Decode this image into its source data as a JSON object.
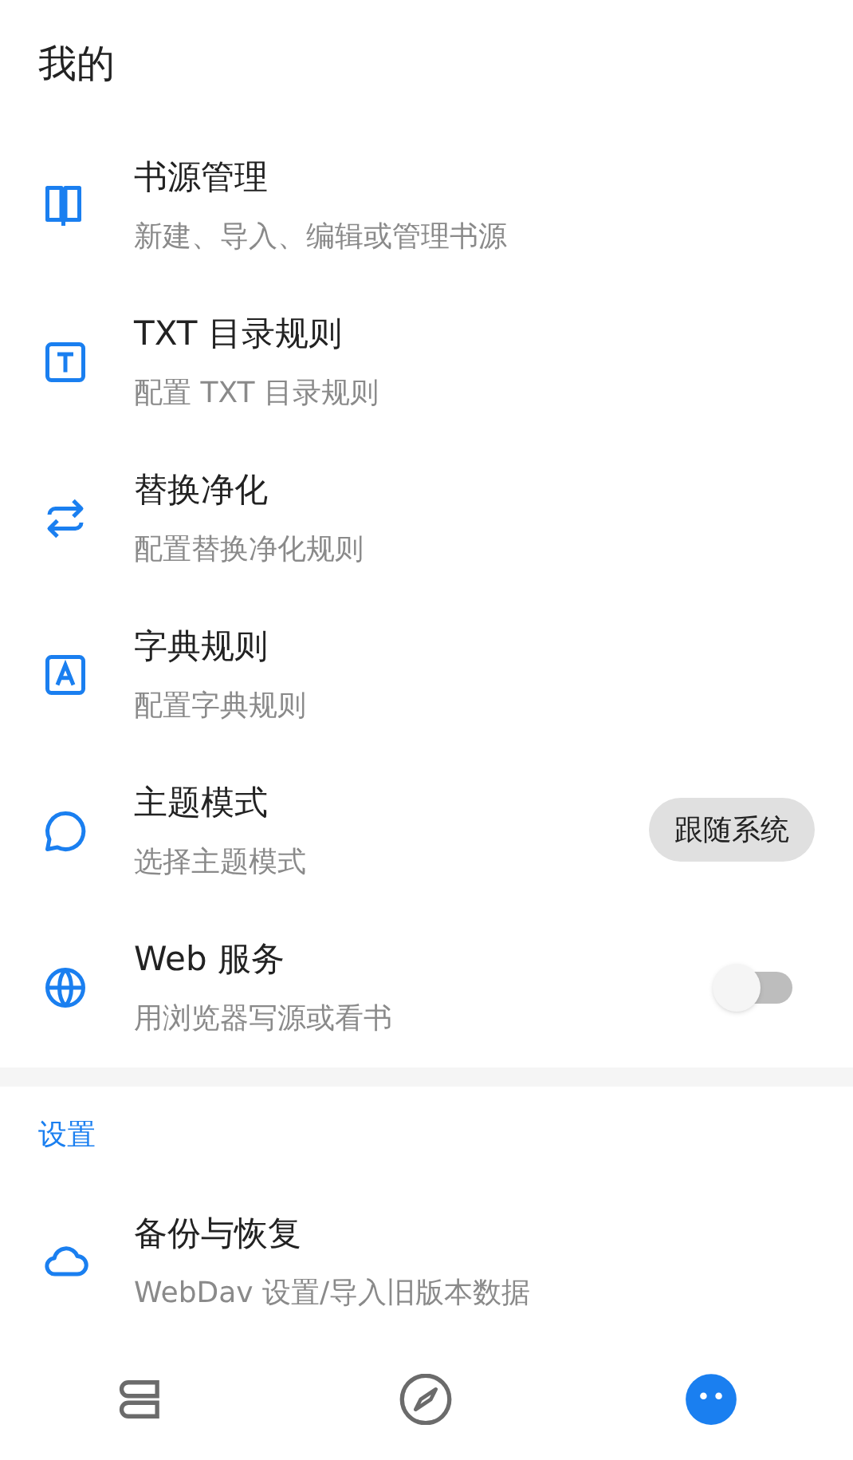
{
  "title": "我的",
  "items": [
    {
      "title": "书源管理",
      "subtitle": "新建、导入、编辑或管理书源"
    },
    {
      "title": "TXT 目录规则",
      "subtitle": "配置 TXT 目录规则"
    },
    {
      "title": "替换净化",
      "subtitle": "配置替换净化规则"
    },
    {
      "title": "字典规则",
      "subtitle": "配置字典规则"
    },
    {
      "title": "主题模式",
      "subtitle": "选择主题模式",
      "kind": "select",
      "value": "跟随系统"
    },
    {
      "title": "Web 服务",
      "subtitle": "用浏览器写源或看书",
      "kind": "switch",
      "on": false
    }
  ],
  "section": {
    "title": "设置",
    "items": [
      {
        "title": "备份与恢复",
        "subtitle": "WebDav 设置/导入旧版本数据"
      }
    ]
  },
  "bottom_nav": [
    {
      "selected": false
    },
    {
      "selected": false
    },
    {
      "selected": true
    }
  ]
}
